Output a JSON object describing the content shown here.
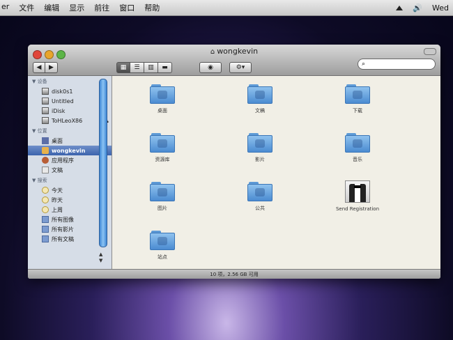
{
  "menubar": {
    "items": [
      "er",
      "文件",
      "编辑",
      "显示",
      "前往",
      "窗口",
      "帮助"
    ],
    "clock": "Wed"
  },
  "window": {
    "title": "wongkevin",
    "nav": {
      "back": "◀",
      "forward": "▶"
    },
    "status": "10 项，2.56 GB 可用"
  },
  "sidebar": {
    "devices_header": "▼ 设备",
    "devices": [
      "disk0s1",
      "Untitled",
      "iDisk",
      "ToHLeoX86"
    ],
    "places_header": "▼ 位置",
    "places": [
      "桌面",
      "wongkevin",
      "应用程序",
      "文稿"
    ],
    "search_header": "▼ 搜索",
    "searches": [
      "今天",
      "昨天",
      "上周",
      "所有图像",
      "所有影片",
      "所有文稿"
    ]
  },
  "files": [
    {
      "label": "桌面",
      "icon": "desktop-folder-icon"
    },
    {
      "label": "文稿",
      "icon": "documents-folder-icon"
    },
    {
      "label": "下载",
      "icon": "downloads-folder-icon"
    },
    {
      "label": "资源库",
      "icon": "library-folder-icon"
    },
    {
      "label": "影片",
      "icon": "movies-folder-icon"
    },
    {
      "label": "音乐",
      "icon": "music-folder-icon"
    },
    {
      "label": "图片",
      "icon": "pictures-folder-icon"
    },
    {
      "label": "公共",
      "icon": "public-folder-icon"
    },
    {
      "label": "Send Registration",
      "icon": "tuxedo-icon"
    },
    {
      "label": "站点",
      "icon": "sites-folder-icon"
    }
  ],
  "colors": {
    "selection": "#3c63ad",
    "folder": "#6aa7e0",
    "sidebar": "#d6dde7"
  }
}
